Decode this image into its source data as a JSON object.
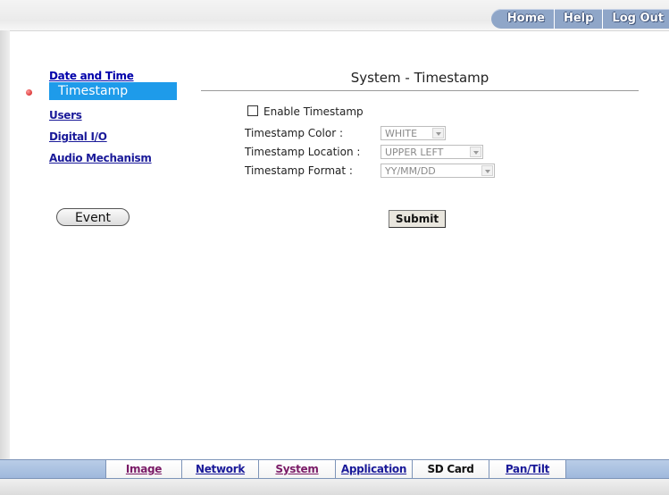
{
  "top_nav": [
    "Home",
    "Help",
    "Log Out"
  ],
  "sidebar": {
    "items": [
      {
        "label": "Date and Time"
      },
      {
        "label": "Timestamp",
        "active": true
      },
      {
        "label": "Users"
      },
      {
        "label": "Digital I/O"
      },
      {
        "label": "Audio Mechanism"
      }
    ],
    "event_button": "Event"
  },
  "main": {
    "title": "System - Timestamp",
    "enable_label": "Enable Timestamp",
    "enable_checked": false,
    "fields": [
      {
        "label": "Timestamp Color :",
        "value": "WHITE"
      },
      {
        "label": "Timestamp Location :",
        "value": "UPPER LEFT"
      },
      {
        "label": "Timestamp Format :",
        "value": "YY/MM/DD"
      }
    ],
    "submit": "Submit"
  },
  "bottom_tabs": [
    {
      "label": "Image",
      "color": "#7a1a66"
    },
    {
      "label": "Network",
      "color": "#1a1a99"
    },
    {
      "label": "System",
      "color": "#7a1a66"
    },
    {
      "label": "Application",
      "color": "#1a1a99"
    },
    {
      "label": "SD Card",
      "color": "#111111",
      "current": true
    },
    {
      "label": "Pan/Tilt",
      "color": "#1a1a99"
    }
  ],
  "colors": {
    "accent": "#1e9bea",
    "link": "#1a1a99",
    "visited_link": "#7a1a66",
    "nav_blue": "#8fa6c8"
  }
}
